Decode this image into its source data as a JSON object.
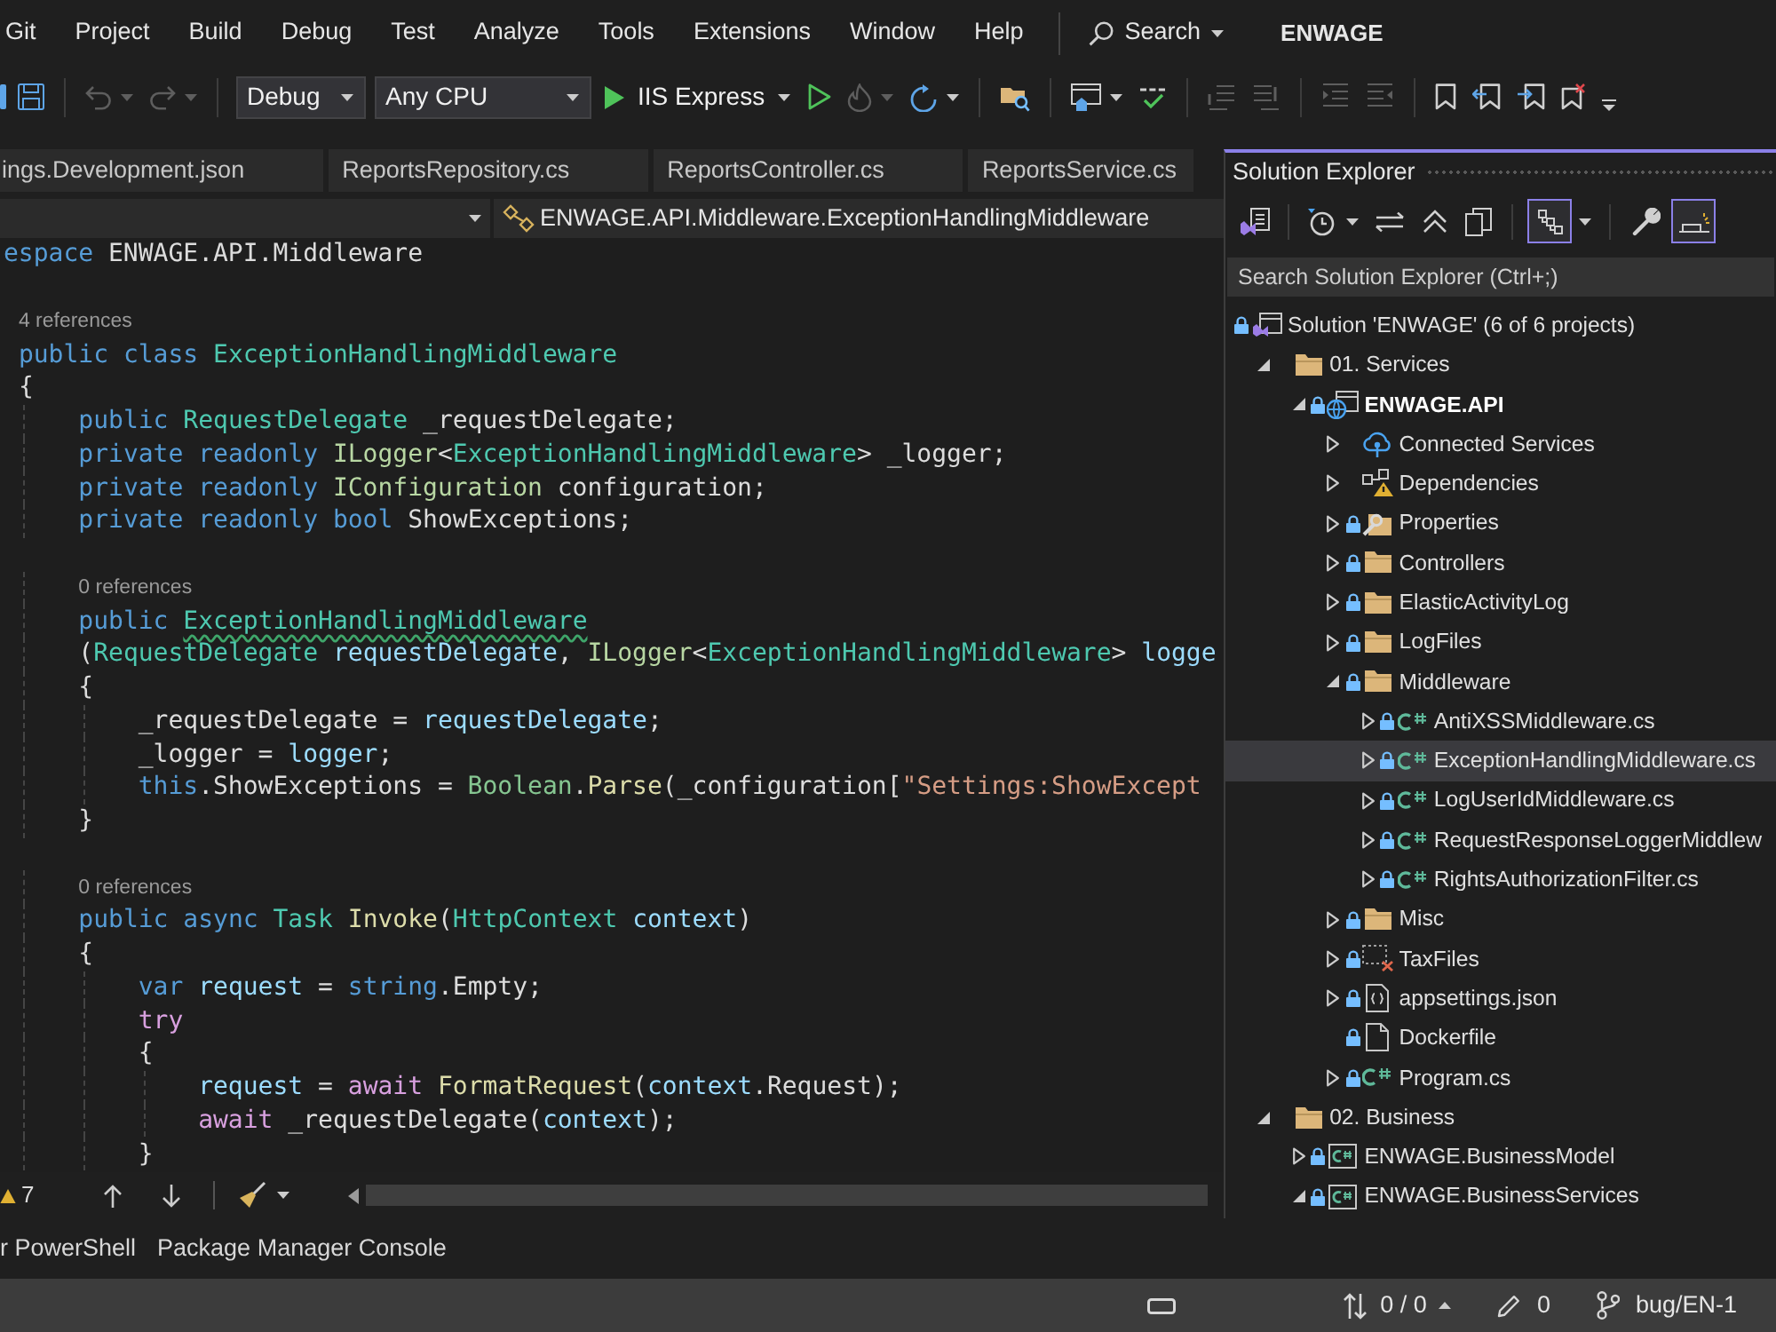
{
  "menu_bar": {
    "items": [
      "Git",
      "Project",
      "Build",
      "Debug",
      "Test",
      "Analyze",
      "Tools",
      "Extensions",
      "Window",
      "Help"
    ],
    "search": "Search",
    "solution_name": "ENWAGE"
  },
  "toolbar": {
    "items": [
      {
        "kind": "partial"
      },
      {
        "kind": "save",
        "disabled": false
      },
      {
        "kind": "separator"
      },
      {
        "kind": "undo",
        "disabled": true,
        "dropdown": true
      },
      {
        "kind": "redo",
        "disabled": true,
        "dropdown": true
      },
      {
        "kind": "separator"
      },
      {
        "kind": "combo",
        "value": "Debug"
      },
      {
        "kind": "combo",
        "value": "Any CPU"
      },
      {
        "kind": "run",
        "label": "IIS Express"
      },
      {
        "kind": "start",
        "disabled": false
      },
      {
        "kind": "hot-reload",
        "disabled": true,
        "dropdown": true
      },
      {
        "kind": "restart",
        "disabled": false,
        "dropdown": true
      },
      {
        "kind": "separator"
      },
      {
        "kind": "find-files",
        "disabled": false
      },
      {
        "kind": "separator"
      },
      {
        "kind": "window",
        "disabled": false,
        "dropdown": true
      },
      {
        "kind": "spell",
        "disabled": false
      },
      {
        "kind": "separator"
      },
      {
        "kind": "comment",
        "disabled": true
      },
      {
        "kind": "uncomment",
        "disabled": true
      },
      {
        "kind": "separator"
      },
      {
        "kind": "outdent",
        "disabled": true
      },
      {
        "kind": "indent",
        "disabled": true
      },
      {
        "kind": "separator"
      },
      {
        "kind": "bookmark",
        "disabled": false
      },
      {
        "kind": "bookmark-prev",
        "disabled": false
      },
      {
        "kind": "bookmark-next",
        "disabled": false
      },
      {
        "kind": "bookmark-clear",
        "disabled": false
      },
      {
        "kind": "overflow"
      }
    ]
  },
  "editor": {
    "tabs": [
      {
        "label": "ings.Development.json",
        "selected": false
      },
      {
        "label": "ReportsRepository.cs",
        "selected": false
      },
      {
        "label": "ReportsController.cs",
        "selected": false
      },
      {
        "label": "ReportsService.cs",
        "selected": false
      }
    ],
    "nav_member": "ENWAGE.API.Middleware.ExceptionHandlingMiddleware",
    "lines": [
      {
        "kind": "code",
        "tokens": [
          {
            "kind": "keyword",
            "text": "espace"
          },
          {
            "kind": "plain",
            "text": " ENWAGE.API.Middleware"
          }
        ]
      },
      {
        "kind": "blank"
      },
      {
        "kind": "codelens",
        "text": " 4 references"
      },
      {
        "kind": "code",
        "tokens": [
          {
            "kind": "keyword",
            "text": " public class"
          },
          {
            "kind": "type",
            "text": " ExceptionHandlingMiddleware"
          }
        ]
      },
      {
        "kind": "code",
        "tokens": [
          {
            "kind": "plain",
            "text": " {"
          }
        ]
      },
      {
        "kind": "code",
        "tokens": [
          {
            "kind": "keyword",
            "text": "     public"
          },
          {
            "kind": "type",
            "text": " RequestDelegate"
          },
          {
            "kind": "plain",
            "text": " _requestDelegate;"
          }
        ]
      },
      {
        "kind": "code",
        "tokens": [
          {
            "kind": "keyword",
            "text": "     private readonly"
          },
          {
            "kind": "interface",
            "text": " ILogger"
          },
          {
            "kind": "plain",
            "text": "<"
          },
          {
            "kind": "type",
            "text": "ExceptionHandlingMiddleware"
          },
          {
            "kind": "plain",
            "text": "> _logger;"
          }
        ]
      },
      {
        "kind": "code",
        "tokens": [
          {
            "kind": "keyword",
            "text": "     private readonly"
          },
          {
            "kind": "interface",
            "text": " IConfiguration"
          },
          {
            "kind": "plain",
            "text": " configuration;"
          }
        ]
      },
      {
        "kind": "code",
        "tokens": [
          {
            "kind": "keyword",
            "text": "     private readonly bool"
          },
          {
            "kind": "plain",
            "text": " ShowExceptions;"
          }
        ]
      },
      {
        "kind": "blank"
      },
      {
        "kind": "codelens",
        "text": "     0 references"
      },
      {
        "kind": "code",
        "tokens": [
          {
            "kind": "keyword",
            "text": "     public "
          },
          {
            "kind": "type",
            "text": "ExceptionHandlingMiddleware",
            "squiggle": true
          }
        ]
      },
      {
        "kind": "code",
        "tokens": [
          {
            "kind": "plain",
            "text": "     ("
          },
          {
            "kind": "type",
            "text": "RequestDelegate"
          },
          {
            "kind": "param",
            "text": " requestDelegate"
          },
          {
            "kind": "plain",
            "text": ", "
          },
          {
            "kind": "interface",
            "text": "ILogger"
          },
          {
            "kind": "plain",
            "text": "<"
          },
          {
            "kind": "type",
            "text": "ExceptionHandlingMiddleware"
          },
          {
            "kind": "plain",
            "text": "> "
          },
          {
            "kind": "param",
            "text": "logge"
          }
        ]
      },
      {
        "kind": "code",
        "tokens": [
          {
            "kind": "plain",
            "text": "     {"
          }
        ]
      },
      {
        "kind": "code",
        "tokens": [
          {
            "kind": "plain",
            "text": "         _requestDelegate = "
          },
          {
            "kind": "param",
            "text": "requestDelegate"
          },
          {
            "kind": "plain",
            "text": ";"
          }
        ]
      },
      {
        "kind": "code",
        "tokens": [
          {
            "kind": "plain",
            "text": "         _logger = "
          },
          {
            "kind": "param",
            "text": "logger"
          },
          {
            "kind": "plain",
            "text": ";"
          }
        ]
      },
      {
        "kind": "code",
        "tokens": [
          {
            "kind": "keyword",
            "text": "         this"
          },
          {
            "kind": "plain",
            "text": ".ShowExceptions = "
          },
          {
            "kind": "struct",
            "text": "Boolean"
          },
          {
            "kind": "plain",
            "text": "."
          },
          {
            "kind": "method",
            "text": "Parse"
          },
          {
            "kind": "plain",
            "text": "(_configuration["
          },
          {
            "kind": "string",
            "text": "\"Settings:ShowExcept"
          }
        ]
      },
      {
        "kind": "code",
        "tokens": [
          {
            "kind": "plain",
            "text": "     }"
          }
        ]
      },
      {
        "kind": "blank"
      },
      {
        "kind": "codelens",
        "text": "     0 references"
      },
      {
        "kind": "code",
        "tokens": [
          {
            "kind": "keyword",
            "text": "     public async"
          },
          {
            "kind": "type",
            "text": " Task"
          },
          {
            "kind": "method",
            "text": " Invoke"
          },
          {
            "kind": "plain",
            "text": "("
          },
          {
            "kind": "type",
            "text": "HttpContext"
          },
          {
            "kind": "param",
            "text": " context"
          },
          {
            "kind": "plain",
            "text": ")"
          }
        ]
      },
      {
        "kind": "code",
        "tokens": [
          {
            "kind": "plain",
            "text": "     {"
          }
        ]
      },
      {
        "kind": "code",
        "tokens": [
          {
            "kind": "keyword",
            "text": "         var"
          },
          {
            "kind": "param",
            "text": " request"
          },
          {
            "kind": "plain",
            "text": " = "
          },
          {
            "kind": "keyword",
            "text": "string"
          },
          {
            "kind": "plain",
            "text": ".Empty;"
          }
        ]
      },
      {
        "kind": "code",
        "tokens": [
          {
            "kind": "control",
            "text": "         try"
          }
        ]
      },
      {
        "kind": "code",
        "tokens": [
          {
            "kind": "plain",
            "text": "         {"
          }
        ]
      },
      {
        "kind": "code",
        "tokens": [
          {
            "kind": "param",
            "text": "             request"
          },
          {
            "kind": "plain",
            "text": " = "
          },
          {
            "kind": "control",
            "text": "await"
          },
          {
            "kind": "method",
            "text": " FormatRequest"
          },
          {
            "kind": "plain",
            "text": "("
          },
          {
            "kind": "param",
            "text": "context"
          },
          {
            "kind": "plain",
            "text": ".Request);"
          }
        ]
      },
      {
        "kind": "code",
        "tokens": [
          {
            "kind": "control",
            "text": "             await"
          },
          {
            "kind": "plain",
            "text": " _requestDelegate("
          },
          {
            "kind": "param",
            "text": "context"
          },
          {
            "kind": "plain",
            "text": ");"
          }
        ]
      },
      {
        "kind": "code",
        "tokens": [
          {
            "kind": "plain",
            "text": "         }"
          }
        ]
      }
    ],
    "warnings": "7"
  },
  "bottom_tabs": [
    {
      "label": "r PowerShell"
    },
    {
      "label": "Package Manager Console"
    }
  ],
  "solution_explorer": {
    "title": "Solution Explorer",
    "toggles": [
      {
        "kind": "tree",
        "on": true
      },
      {
        "kind": "preview",
        "on": true
      }
    ],
    "search": {
      "placeholder": "Search Solution Explorer (Ctrl+;)"
    },
    "tree": [
      {
        "label": "Solution 'ENWAGE' (6 of 6 projects)",
        "kind": "solution",
        "locked": true,
        "selected": false,
        "children": [
          {
            "label": "01. Services",
            "kind": "folder",
            "expanded": true,
            "locked": false,
            "selected": false,
            "children": [
              {
                "label": "ENWAGE.API",
                "kind": "web-project",
                "expanded": true,
                "locked": true,
                "selected": false,
                "startup": true,
                "children": [
                  {
                    "label": "Connected Services",
                    "kind": "connected",
                    "expanded": false,
                    "locked": false,
                    "selected": false
                  },
                  {
                    "label": "Dependencies",
                    "kind": "dependencies",
                    "expanded": false,
                    "locked": false,
                    "selected": false
                  },
                  {
                    "label": "Properties",
                    "kind": "properties",
                    "expanded": false,
                    "locked": true,
                    "selected": false
                  },
                  {
                    "label": "Controllers",
                    "kind": "folder",
                    "expanded": false,
                    "locked": true,
                    "selected": false
                  },
                  {
                    "label": "ElasticActivityLog",
                    "kind": "folder",
                    "expanded": false,
                    "locked": true,
                    "selected": false
                  },
                  {
                    "label": "LogFiles",
                    "kind": "folder",
                    "expanded": false,
                    "locked": true,
                    "selected": false
                  },
                  {
                    "label": "Middleware",
                    "kind": "folder",
                    "expanded": true,
                    "locked": true,
                    "selected": false,
                    "children": [
                      {
                        "label": "AntiXSSMiddleware.cs",
                        "kind": "csharp",
                        "expanded": false,
                        "locked": true,
                        "selected": false
                      },
                      {
                        "label": "ExceptionHandlingMiddleware.cs",
                        "kind": "csharp",
                        "expanded": false,
                        "locked": true,
                        "selected": true
                      },
                      {
                        "label": "LogUserIdMiddleware.cs",
                        "kind": "csharp",
                        "expanded": false,
                        "locked": true,
                        "selected": false
                      },
                      {
                        "label": "RequestResponseLoggerMiddlew",
                        "kind": "csharp",
                        "expanded": false,
                        "locked": true,
                        "selected": false
                      },
                      {
                        "label": "RightsAuthorizationFilter.cs",
                        "kind": "csharp",
                        "expanded": false,
                        "locked": true,
                        "selected": false
                      }
                    ]
                  },
                  {
                    "label": "Misc",
                    "kind": "folder",
                    "expanded": false,
                    "locked": true,
                    "selected": false
                  },
                  {
                    "label": "TaxFiles",
                    "kind": "excluded-folder",
                    "expanded": false,
                    "locked": true,
                    "selected": false
                  },
                  {
                    "label": "appsettings.json",
                    "kind": "json",
                    "expanded": false,
                    "locked": true,
                    "selected": false
                  },
                  {
                    "label": "Dockerfile",
                    "kind": "file",
                    "locked": true,
                    "selected": false
                  },
                  {
                    "label": "Program.cs",
                    "kind": "csharp",
                    "expanded": false,
                    "locked": true,
                    "selected": false
                  }
                ]
              }
            ]
          },
          {
            "label": "02. Business",
            "kind": "folder",
            "expanded": true,
            "locked": false,
            "selected": false,
            "children": [
              {
                "label": "ENWAGE.BusinessModel",
                "kind": "project",
                "expanded": false,
                "locked": true,
                "selected": false,
                "startup": false
              },
              {
                "label": "ENWAGE.BusinessServices",
                "kind": "project",
                "expanded": true,
                "locked": true,
                "selected": false,
                "startup": false
              }
            ]
          }
        ]
      }
    ]
  },
  "status_bar": {
    "changes": "0 / 0",
    "edits": "0",
    "branch": "bug/EN-1"
  }
}
